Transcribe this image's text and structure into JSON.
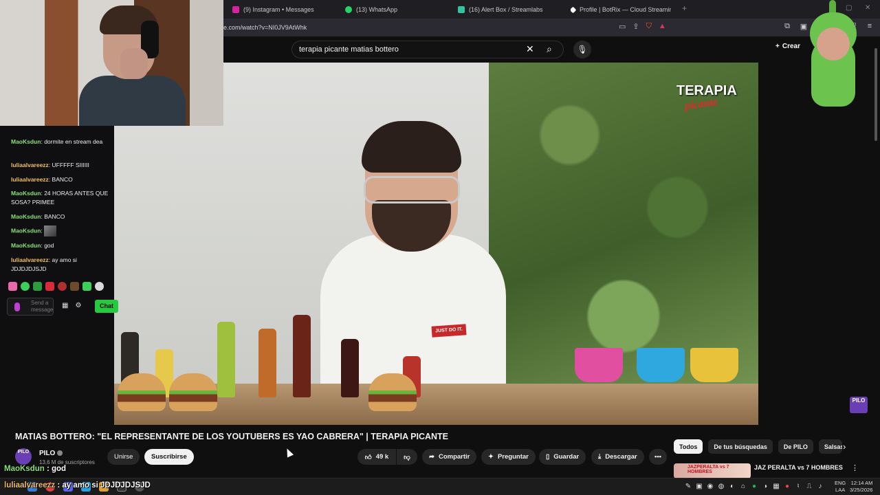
{
  "browser": {
    "tabs": [
      {
        "label": "(9) Instagram • Messages",
        "color": "#d6249f"
      },
      {
        "label": "(13) WhatsApp",
        "color": "#25d366"
      },
      {
        "label": "(16) Alert Box / Streamlabs",
        "color": "#31c3a2"
      },
      {
        "label": "Profile | BotRix — Cloud Streaming B",
        "color": "#ffffff"
      }
    ],
    "url": "e.com/watch?v=NI0JV9AtWhk"
  },
  "youtube": {
    "search_value": "terapia picante matias bottero",
    "create_label": "Crear",
    "video_title": "MATIAS BOTTERO: \"EL REPRESENTANTE DE LOS YOUTUBERS ES YAO CABRERA\" | TERAPIA PICANTE",
    "overlay_brand": "TERAPIA",
    "overlay_brand_script": "picante",
    "shirt_text": "JUST DO IT.",
    "channel": {
      "avatar_text": "PILO",
      "name": "PILO",
      "subscribers": "13,6 M de suscriptores"
    },
    "join_label": "Unirse",
    "subscribe_label": "Suscribirse",
    "likes": "49 k",
    "share_label": "Compartir",
    "ask_label": "Preguntar",
    "save_label": "Guardar",
    "download_label": "Descargar",
    "chips": [
      "Todos",
      "De tus búsquedas",
      "De PILO",
      "Salsas"
    ],
    "recommended": {
      "thumb_text": "JAZPERALTA vs 7 HOMBRES",
      "title": "JAZ PERALTA vs 7 HOMBRES"
    }
  },
  "chat": {
    "messages": [
      {
        "user": "MaoKsdun",
        "text": "dormite en stream dea",
        "color": "u1"
      },
      {
        "user": "luliaalvareezz",
        "text": "UFFFFF SIIIIII",
        "color": "u2"
      },
      {
        "user": "luliaalvareezz",
        "text": "BANCO",
        "color": "u2"
      },
      {
        "user": "MaoKsdun",
        "text": "24 HORAS ANTES QUE SOSA? PRIMEE",
        "color": "u1"
      },
      {
        "user": "MaoKsdun",
        "text": "BANCO",
        "color": "u1"
      },
      {
        "user": "MaoKsdun",
        "text": "",
        "color": "u1"
      },
      {
        "user": "MaoKsdun",
        "text": "god",
        "color": "u1"
      },
      {
        "user": "luliaalvareezz",
        "text": "ay amo si JDJDJDJSJD",
        "color": "u2"
      }
    ],
    "input_placeholder": "Send a message",
    "send_label": "Chat"
  },
  "ticker": {
    "line1_user": "MaoKsdun",
    "line1_text": " : god",
    "line2_user": "luliaalvareezz",
    "line2_text": " : ay amo si JDJDJDJSJD"
  },
  "taskbar": {
    "lang_top": "ENG",
    "lang_bottom": "LAA",
    "time": "12:14 AM",
    "date": "3/25/2026"
  },
  "colors": {
    "youtube_bg": "#0f0f0f",
    "chat_send": "#27c93f",
    "channel_brand": "#6a3fb5"
  }
}
